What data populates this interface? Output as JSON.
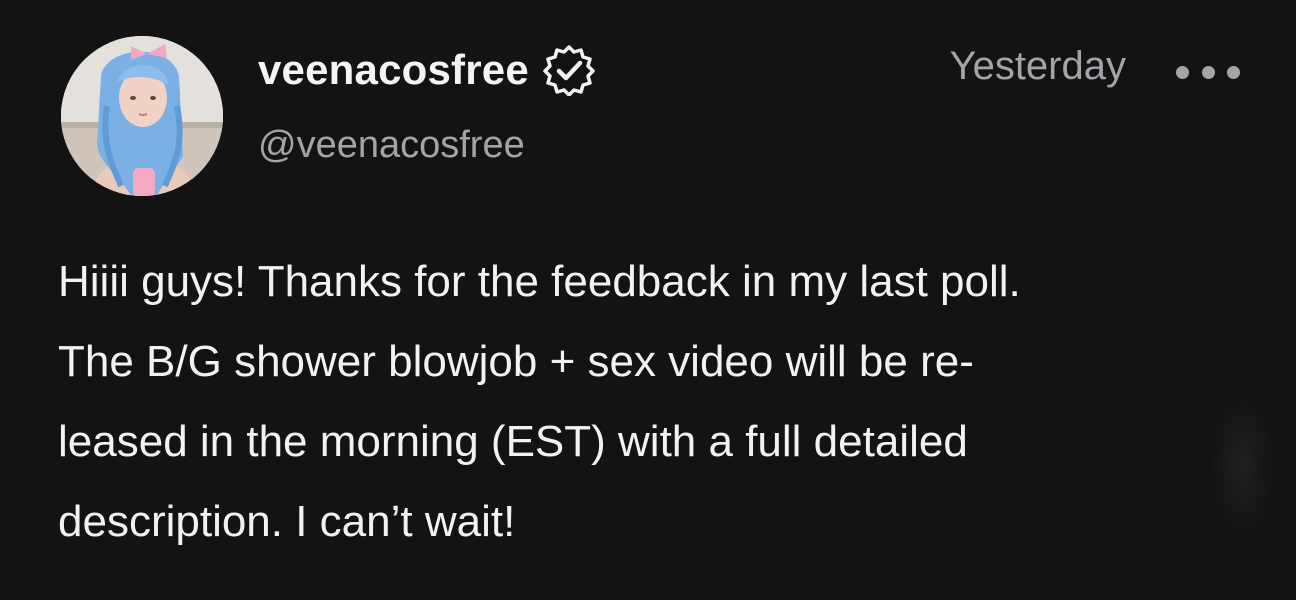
{
  "post": {
    "author": {
      "display_name": "veenacosfree",
      "handle": "@veenacosfree",
      "verified_icon": "verified-badge-icon",
      "avatar_icon": "profile-photo"
    },
    "timestamp": "Yesterday",
    "more_icon": "ellipsis-icon",
    "body_lines": [
      "Hiiii guys! Thanks for the feedback in my last poll.",
      "The B/G shower blowjob + sex video will be re-",
      "leased in the morning (EST) with a full detailed",
      "description. I can’t wait!"
    ]
  },
  "colors": {
    "background": "#131314",
    "primary_text": "#f2f2f2",
    "secondary_text": "#a3a4a8"
  }
}
